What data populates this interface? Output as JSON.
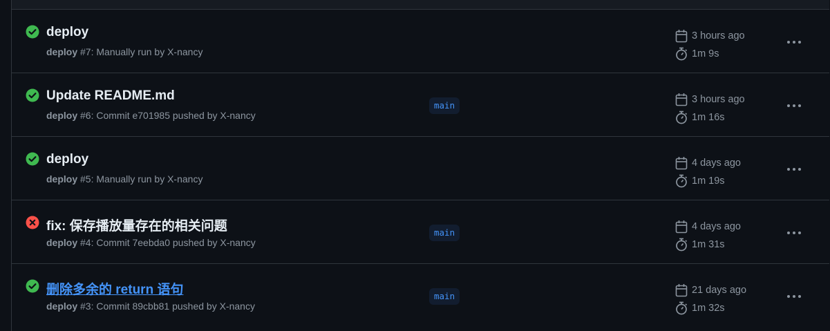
{
  "runs": [
    {
      "status": "success",
      "status_color": "#3fb950",
      "status_icon": "check-circle-fill-icon",
      "title": "deploy",
      "title_is_link": false,
      "workflow": "deploy",
      "run_info": " #7: Manually run by X-nancy",
      "branch": "",
      "time_ago": "3 hours ago",
      "duration": "1m 9s"
    },
    {
      "status": "success",
      "status_color": "#3fb950",
      "status_icon": "check-circle-fill-icon",
      "title": "Update README.md",
      "title_is_link": false,
      "workflow": "deploy",
      "run_info": " #6: Commit e701985 pushed by X-nancy",
      "branch": "main",
      "time_ago": "3 hours ago",
      "duration": "1m 16s"
    },
    {
      "status": "success",
      "status_color": "#3fb950",
      "status_icon": "check-circle-fill-icon",
      "title": "deploy",
      "title_is_link": false,
      "workflow": "deploy",
      "run_info": " #5: Manually run by X-nancy",
      "branch": "",
      "time_ago": "4 days ago",
      "duration": "1m 19s"
    },
    {
      "status": "failure",
      "status_color": "#f85149",
      "status_icon": "x-circle-fill-icon",
      "title": "fix: 保存播放量存在的相关问题",
      "title_is_link": false,
      "workflow": "deploy",
      "run_info": " #4: Commit 7eebda0 pushed by X-nancy",
      "branch": "main",
      "time_ago": "4 days ago",
      "duration": "1m 31s"
    },
    {
      "status": "success",
      "status_color": "#3fb950",
      "status_icon": "check-circle-fill-icon",
      "title": "删除多余的 return 语句",
      "title_is_link": true,
      "workflow": "deploy",
      "run_info": " #3: Commit 89cbb81 pushed by X-nancy",
      "branch": "main",
      "time_ago": "21 days ago",
      "duration": "1m 32s"
    }
  ],
  "icons": {
    "calendar": "calendar-icon",
    "stopwatch": "stopwatch-icon",
    "more": "kebab-horizontal-icon"
  },
  "colors": {
    "background": "#0d1117",
    "border": "#30363d",
    "muted_text": "#8d96a0",
    "link": "#4493f8"
  }
}
